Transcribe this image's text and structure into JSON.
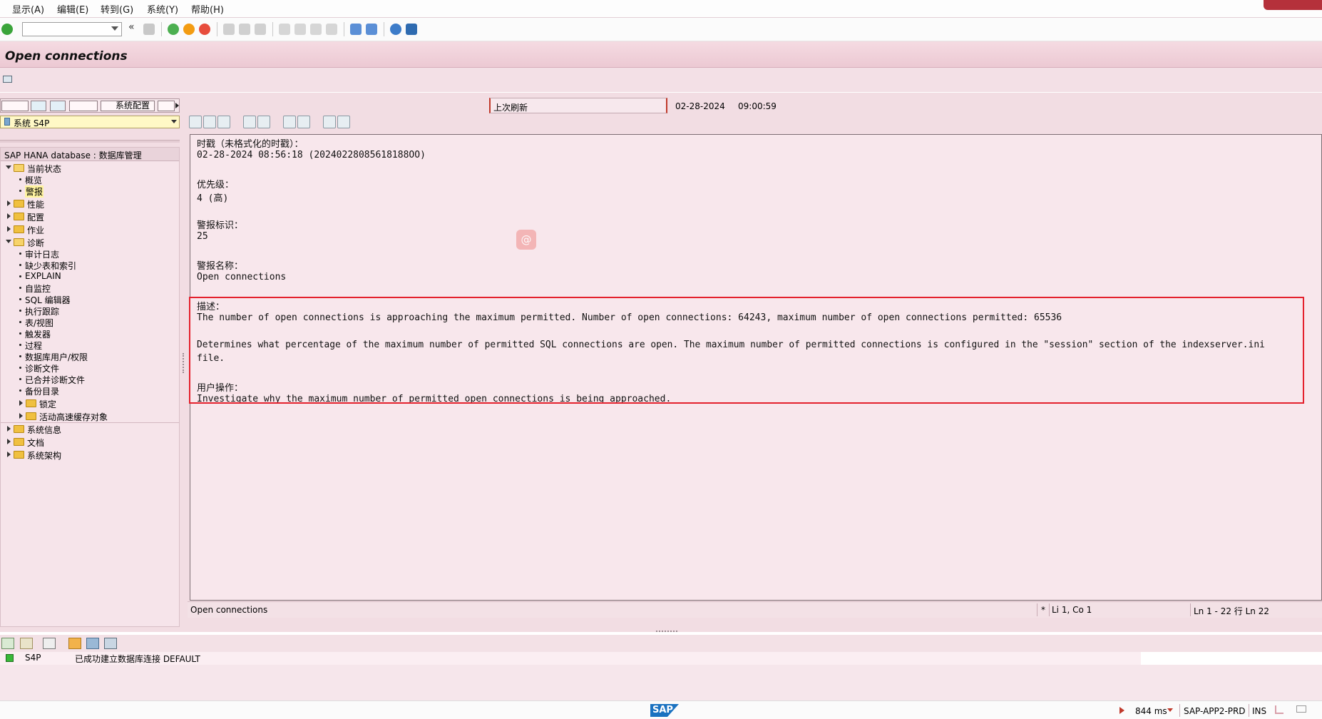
{
  "menu": [
    "显示(A)",
    "编辑(E)",
    "转到(G)",
    "系统(Y)",
    "帮助(H)"
  ],
  "title": "Open connections",
  "left": {
    "sysconfig_label": "系统配置",
    "system_field": "系统 S4P",
    "tree_header": "SAP HANA database : 数据库管理",
    "nodes": {
      "current_status": "当前状态",
      "overview": "概览",
      "alerts": "警报",
      "performance": "性能",
      "configuration": "配置",
      "jobs": "作业",
      "diagnosis": "诊断",
      "audit_log": "审计日志",
      "missing_tables": "缺少表和索引",
      "explain": "EXPLAIN",
      "self_monitor": "自监控",
      "sql_editor": "SQL 编辑器",
      "exec_trace": "执行跟踪",
      "tables_views": "表/视图",
      "triggers": "触发器",
      "procedures": "过程",
      "db_users": "数据库用户/权限",
      "diag_files": "诊断文件",
      "merged_diag": "已合并诊断文件",
      "backup_catalog": "备份目录",
      "locks": "锁定",
      "active_cache": "活动高速缓存对象",
      "system_info": "系统信息",
      "documents": "文档",
      "system_landscape": "系统架构"
    }
  },
  "refresh": {
    "label": "上次刷新",
    "date": "02-28-2024",
    "time": "09:00:59"
  },
  "editor": {
    "lines": [
      "时戳（未格式化的时戳）：",
      "02-28-2024 08:56:18 (20240228085618188OO)",
      "优先级：",
      "4 (高)",
      "警报标识：",
      "25",
      "警报名称：",
      "Open connections",
      "描述：",
      "The number of open connections is approaching the maximum permitted. Number of open connections: 64243, maximum number of open connections permitted: 65536",
      "Determines what percentage of the maximum number of permitted SQL connections are open. The maximum number of permitted connections is configured in the \"session\" section of the indexserver.ini",
      "file.",
      "用户操作：",
      "Investigate why the maximum number of permitted open connections is being approached."
    ],
    "status_name": "Open connections",
    "status_mark": "*",
    "status_pos": "Li 1, Co 1",
    "status_lines": "Ln 1 - 22 行 Ln 22"
  },
  "messages": {
    "system": "S4P",
    "text": "已成功建立数据库连接 DEFAULT"
  },
  "statusbar": {
    "response_time": "844 ms",
    "server": "SAP-APP2-PRD",
    "mode": "INS",
    "logo": "SAP"
  },
  "colors": {
    "title_pink": "#ecc9d3",
    "main_pink": "#f2dde3",
    "highlight_red": "#e4212d"
  }
}
